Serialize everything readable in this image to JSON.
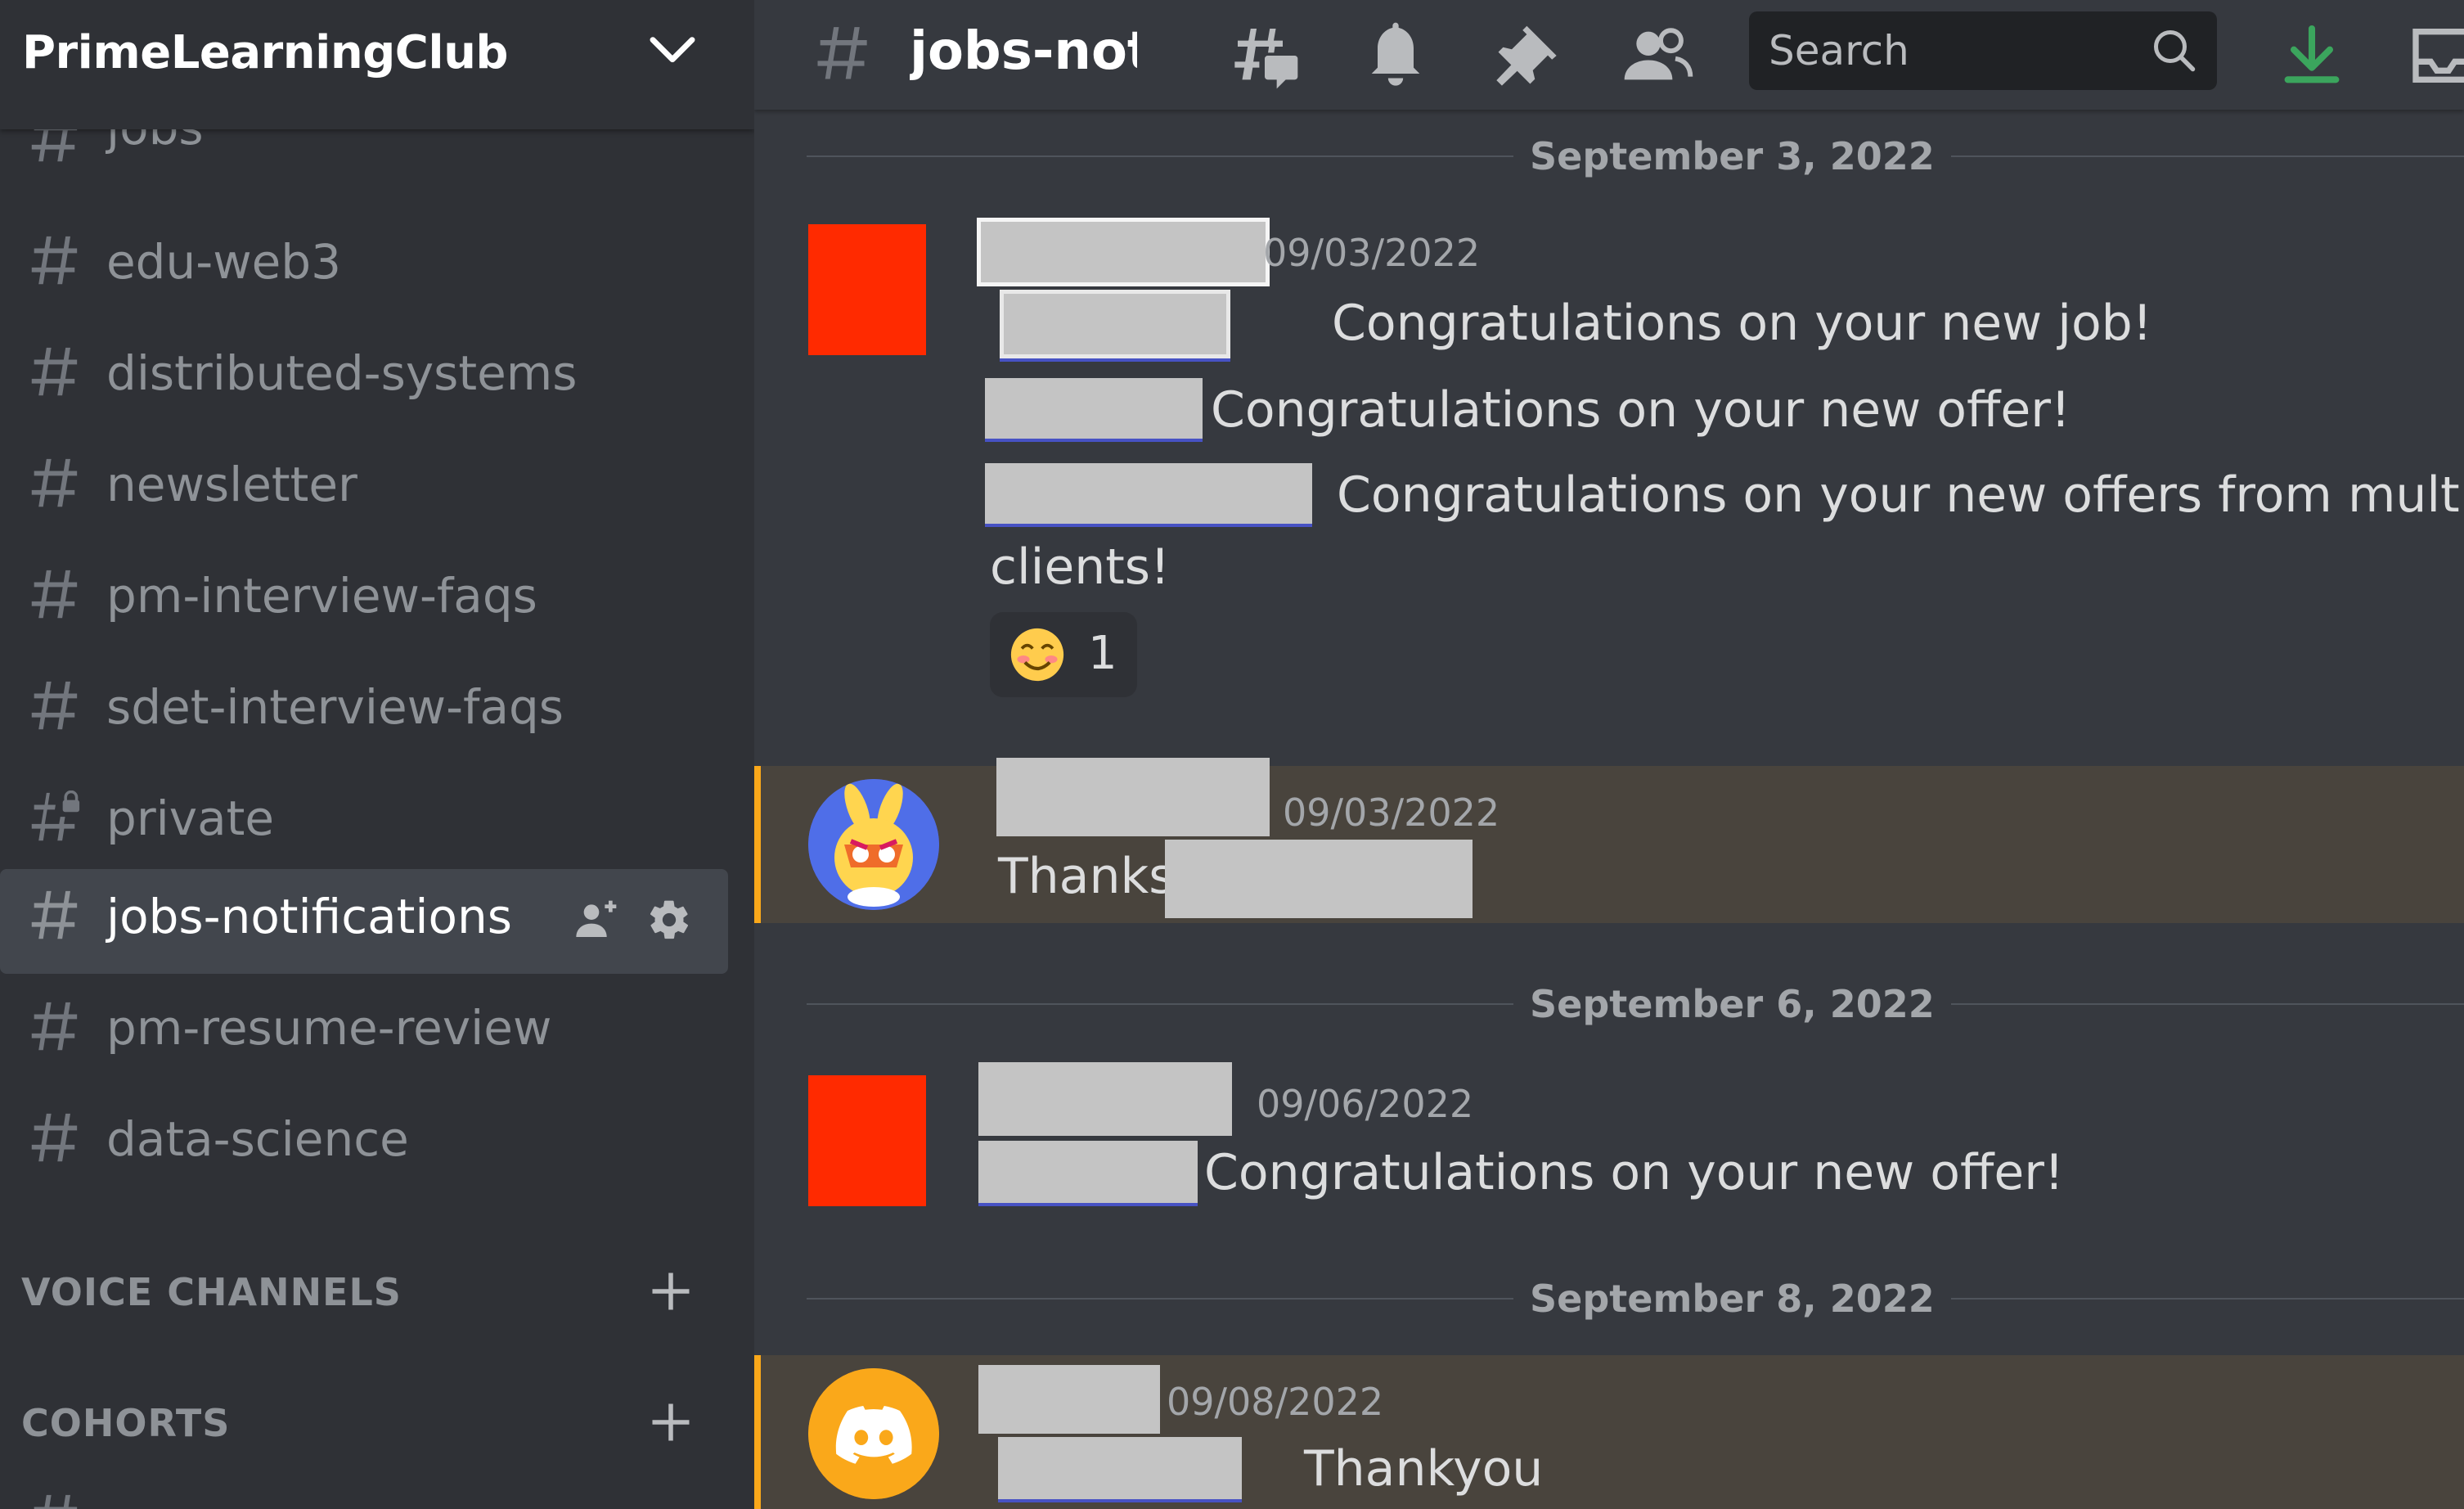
{
  "server": {
    "name": "PrimeLearningClub"
  },
  "channels": [
    {
      "name": "jobs",
      "type": "text"
    },
    {
      "name": "edu-web3",
      "type": "text"
    },
    {
      "name": "distributed-systems",
      "type": "text"
    },
    {
      "name": "newsletter",
      "type": "text"
    },
    {
      "name": "pm-interview-faqs",
      "type": "text"
    },
    {
      "name": "sdet-interview-faqs",
      "type": "text"
    },
    {
      "name": "private",
      "type": "private"
    },
    {
      "name": "jobs-notifications",
      "type": "text",
      "selected": true
    },
    {
      "name": "pm-resume-review",
      "type": "text"
    },
    {
      "name": "data-science",
      "type": "text"
    }
  ],
  "categories": {
    "voice": "VOICE CHANNELS",
    "cohorts": "COHORTS"
  },
  "topbar": {
    "channel_title": "jobs-notifications",
    "search_placeholder": "Search",
    "icons": [
      "threads-icon",
      "bell-icon",
      "pin-icon",
      "members-icon",
      "search-icon",
      "download-icon",
      "inbox-icon"
    ]
  },
  "messages": {
    "divider_1": "September 3, 2022",
    "m1": {
      "timestamp": "09/03/2022",
      "line1": "Congratulations on your new job!",
      "line2": "Congratulations on your new offer!",
      "line3": "Congratulations on your new offers from multiple",
      "line3b": "clients!",
      "reaction_count": "1"
    },
    "m2": {
      "timestamp": "09/03/2022",
      "text": "Thanks"
    },
    "divider_2": "September 6, 2022",
    "m3": {
      "timestamp": "09/06/2022",
      "text": "Congratulations on your new offer!"
    },
    "divider_3": "September 8, 2022",
    "m4": {
      "timestamp": "09/08/2022",
      "text": "Thankyou"
    }
  },
  "colors": {
    "sidebar_bg": "#2f3136",
    "chat_bg": "#36393f",
    "highlight_bg": "#49443d",
    "highlight_border": "#faa81a",
    "download_accent": "#3ba55d",
    "avatar_red": "#ff2a00",
    "discord_orange": "#faa81a"
  }
}
